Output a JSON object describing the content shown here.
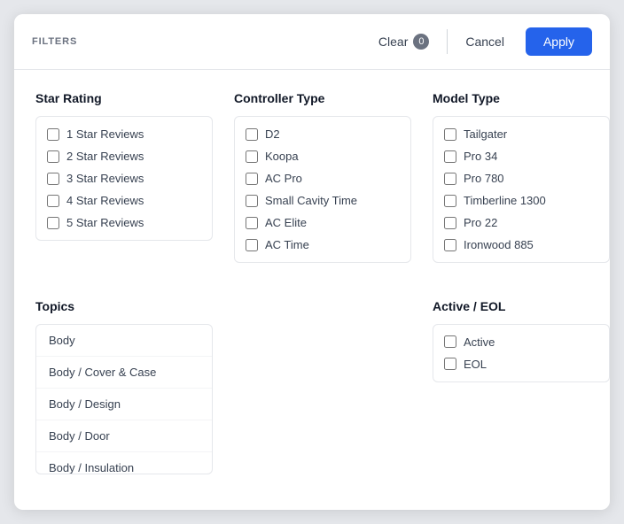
{
  "header": {
    "title": "FILTERS",
    "clear_label": "Clear",
    "clear_count": "0",
    "cancel_label": "Cancel",
    "apply_label": "Apply"
  },
  "star_rating": {
    "title": "Star Rating",
    "items": [
      {
        "label": "1 Star Reviews"
      },
      {
        "label": "2 Star Reviews"
      },
      {
        "label": "3 Star Reviews"
      },
      {
        "label": "4 Star Reviews"
      },
      {
        "label": "5 Star Reviews"
      }
    ]
  },
  "controller_type": {
    "title": "Controller Type",
    "items": [
      {
        "label": "D2"
      },
      {
        "label": "Koopa"
      },
      {
        "label": "AC Pro"
      },
      {
        "label": "Small Cavity Time"
      },
      {
        "label": "AC Elite"
      },
      {
        "label": "AC Time"
      }
    ]
  },
  "model_type": {
    "title": "Model Type",
    "items": [
      {
        "label": "Tailgater"
      },
      {
        "label": "Pro 34"
      },
      {
        "label": "Pro 780"
      },
      {
        "label": "Timberline 1300"
      },
      {
        "label": "Pro 22"
      },
      {
        "label": "Ironwood 885"
      }
    ]
  },
  "topics": {
    "title": "Topics",
    "items": [
      {
        "label": "Body"
      },
      {
        "label": "Body / Cover & Case"
      },
      {
        "label": "Body / Design"
      },
      {
        "label": "Body / Door"
      },
      {
        "label": "Body / Insulation"
      }
    ]
  },
  "active_eol": {
    "title": "Active / EOL",
    "items": [
      {
        "label": "Active"
      },
      {
        "label": "EOL"
      }
    ]
  }
}
